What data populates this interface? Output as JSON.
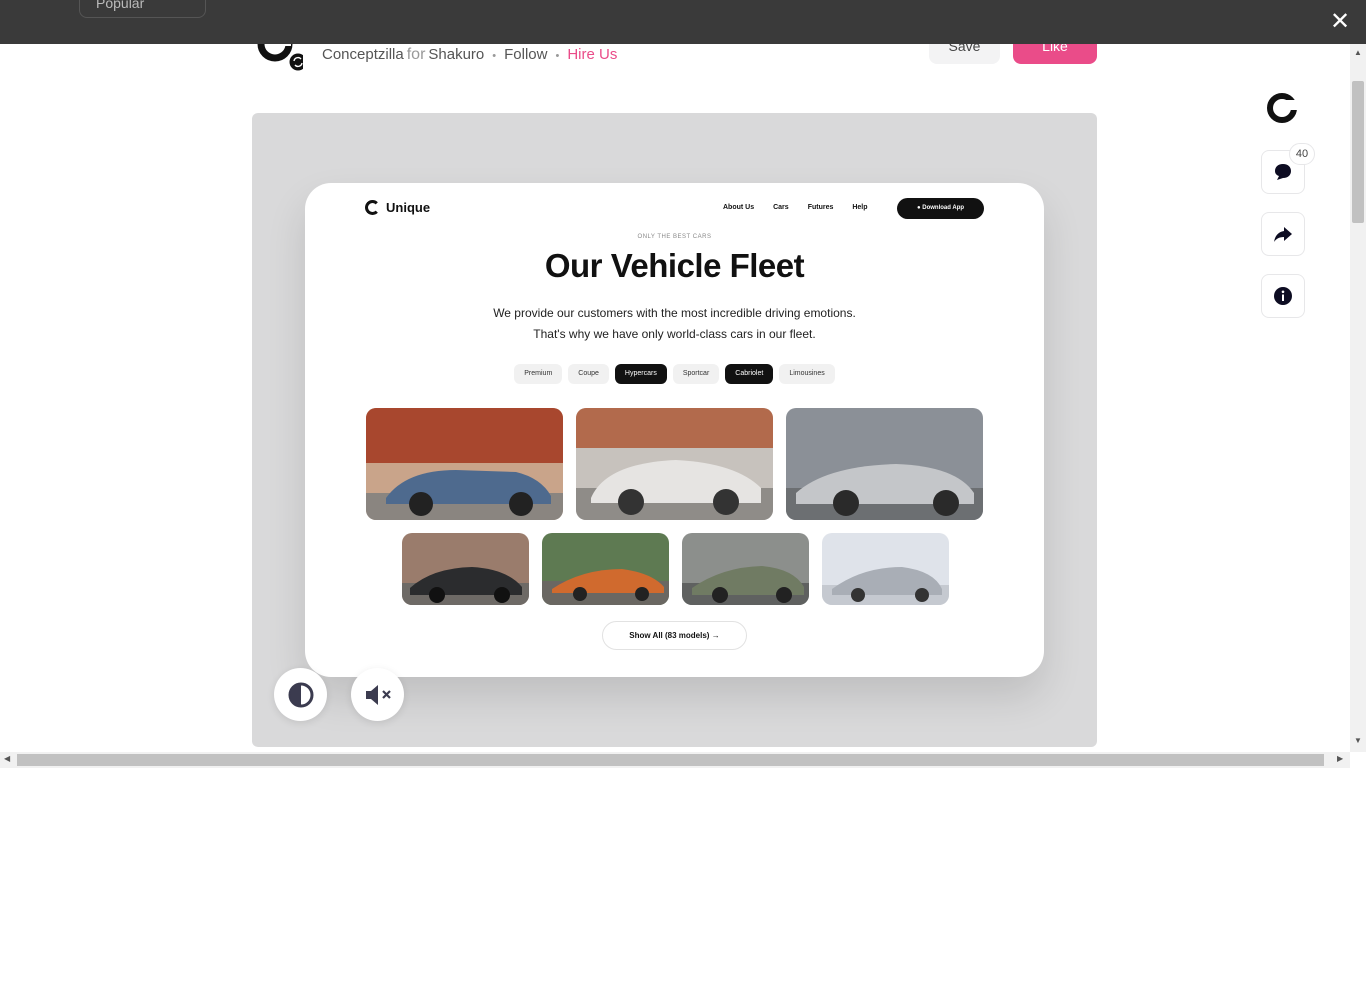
{
  "overlay": {
    "behind_button_label": "Popular",
    "close_icon": "close-icon"
  },
  "header": {
    "author": "Conceptzilla",
    "for_word": "for",
    "team": "Shakuro",
    "follow": "Follow",
    "hire": "Hire Us",
    "save": "Save",
    "like": "Like",
    "hire_color": "#ea4c89",
    "like_color": "#ea4c89"
  },
  "shot": {
    "brand": "Unique",
    "nav": [
      "About Us",
      "Cars",
      "Futures",
      "Help"
    ],
    "download": "Download App",
    "eyebrow": "ONLY THE BEST CARS",
    "title": "Our Vehicle Fleet",
    "desc_line1": "We provide our customers with the most incredible driving emotions.",
    "desc_line2": "That's why we have only world-class cars in our fleet.",
    "chips": [
      {
        "label": "Premium",
        "active": false
      },
      {
        "label": "Coupe",
        "active": false
      },
      {
        "label": "Hypercars",
        "active": true
      },
      {
        "label": "Sportcar",
        "active": false
      },
      {
        "label": "Cabriolet",
        "active": true
      },
      {
        "label": "Limousines",
        "active": false
      }
    ],
    "show_all": "Show All (83 models)"
  },
  "sidebar": {
    "comments_count": "40"
  },
  "colors": {
    "accent": "#ea4c89",
    "dark": "#111111"
  }
}
